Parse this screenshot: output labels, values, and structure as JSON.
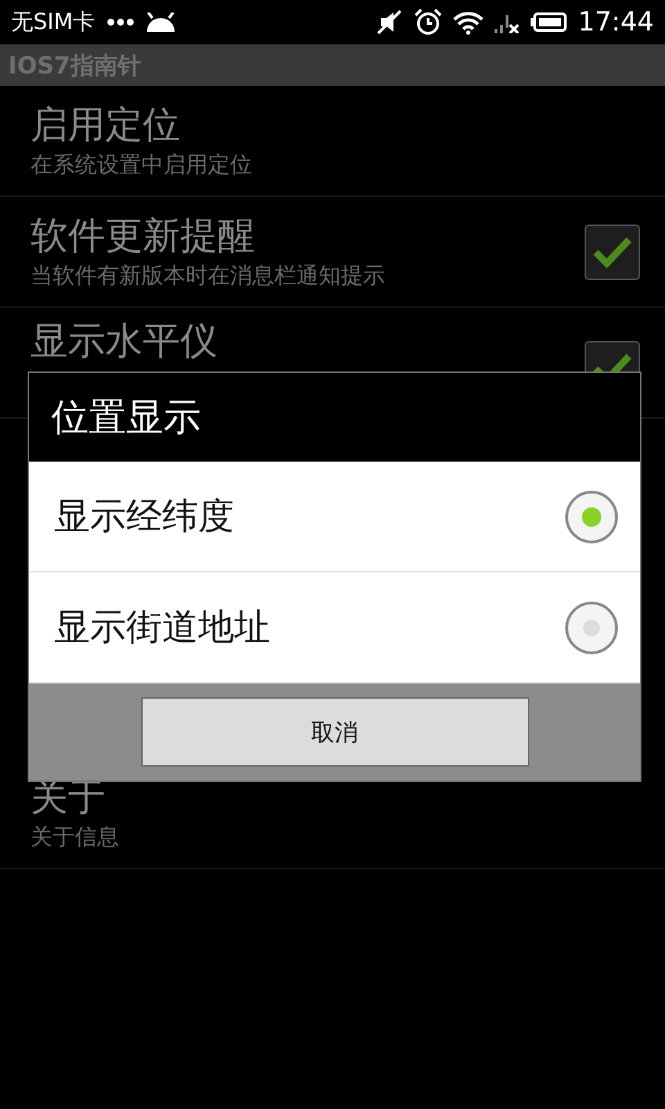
{
  "status_bar": {
    "carrier": "无SIM卡",
    "time": "17:44"
  },
  "app_bar": {
    "title": "IOS7指南针"
  },
  "settings": [
    {
      "kind": "plain",
      "title": "启用定位",
      "subtitle": "在系统设置中启用定位"
    },
    {
      "kind": "checkbox",
      "title": "软件更新提醒",
      "subtitle": "当软件有新版本时在消息栏通知提示",
      "checked": true
    },
    {
      "kind": "checkbox",
      "title": "显示水平仪",
      "checked": true
    },
    {
      "kind": "gap"
    },
    {
      "kind": "plain",
      "title": "关于",
      "subtitle": "关于信息"
    }
  ],
  "dialog": {
    "title": "位置显示",
    "options": [
      {
        "label": "显示经纬度",
        "selected": true
      },
      {
        "label": "显示街道地址",
        "selected": false
      }
    ],
    "cancel": "取消"
  }
}
